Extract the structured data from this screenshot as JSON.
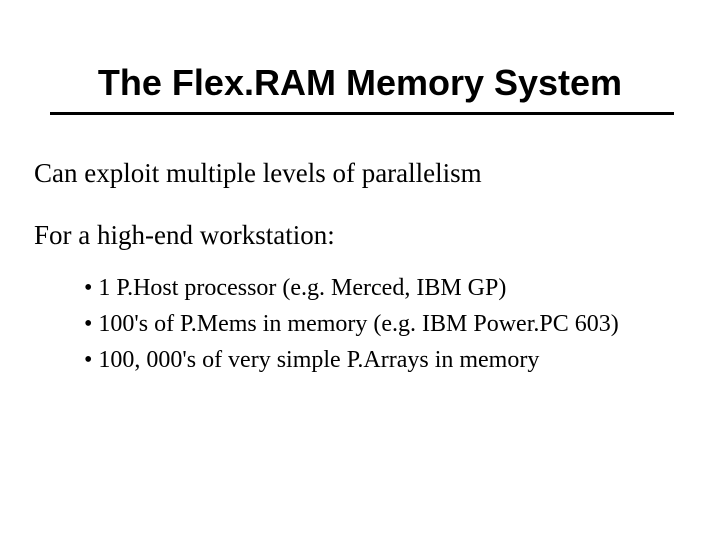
{
  "title": "The Flex.RAM Memory System",
  "para1": "Can exploit multiple levels of parallelism",
  "para2": "For a high-end workstation:",
  "bullets": {
    "b1": "• 1 P.Host processor (e.g. Merced, IBM GP)",
    "b2": "• 100's of P.Mems in memory (e.g. IBM Power.PC 603)",
    "b3": "• 100, 000's of very simple P.Arrays in memory"
  }
}
